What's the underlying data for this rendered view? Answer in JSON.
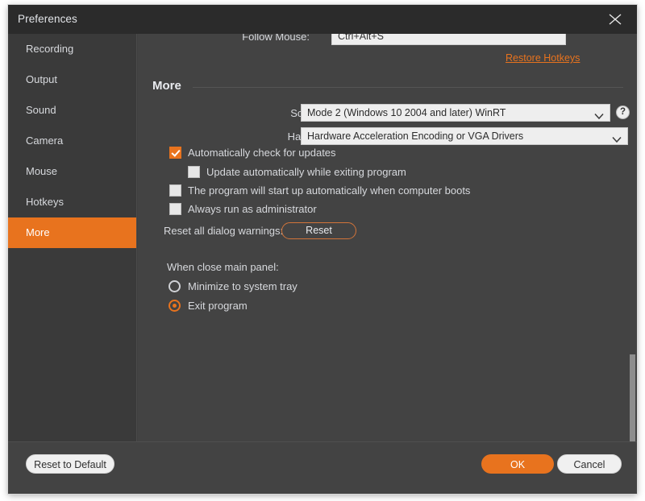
{
  "window": {
    "title": "Preferences",
    "close_icon": "close-icon",
    "accent_color": "#e8731e",
    "background_color": "#434343",
    "titlebar_color": "#2b2b2b",
    "sidebar_color": "#3a3a3a"
  },
  "sidebar": {
    "items": [
      {
        "label": "Recording",
        "active": false
      },
      {
        "label": "Output",
        "active": false
      },
      {
        "label": "Sound",
        "active": false
      },
      {
        "label": "Camera",
        "active": false
      },
      {
        "label": "Mouse",
        "active": false
      },
      {
        "label": "Hotkeys",
        "active": false
      },
      {
        "label": "More",
        "active": true
      }
    ]
  },
  "hotkeys_remnant": {
    "follow_mouse_label": "Follow Mouse:",
    "follow_mouse_value": "Ctrl+Alt+S",
    "restore_hotkeys_label": "Restore Hotkeys"
  },
  "more": {
    "section_title": "More",
    "screen_capture_mode": {
      "label": "Screen Capture Mode:",
      "value": "Mode 2 (Windows 10 2004 and later) WinRT",
      "chevron_icon": "chevron-down-icon",
      "help_icon": "help-icon",
      "help_glyph": "?"
    },
    "hardware_acceleration": {
      "label": "Hardware Acceleration:",
      "value": "Hardware Acceleration Encoding or VGA Drivers",
      "chevron_icon": "chevron-down-icon"
    },
    "checkboxes": [
      {
        "label": "Automatically check for updates",
        "checked": true
      },
      {
        "label": "Update automatically while exiting program",
        "checked": false
      },
      {
        "label": "The program will start up automatically when computer boots",
        "checked": false
      },
      {
        "label": "Always run as administrator",
        "checked": false
      }
    ],
    "reset_warnings": {
      "label": "Reset all dialog warnings:",
      "button_label": "Reset"
    },
    "close_panel": {
      "group_label": "When close main panel:",
      "options": [
        {
          "label": "Minimize to system tray",
          "selected": false
        },
        {
          "label": "Exit program",
          "selected": true
        }
      ]
    }
  },
  "footer": {
    "reset_to_default": "Reset to Default",
    "ok": "OK",
    "cancel": "Cancel"
  }
}
